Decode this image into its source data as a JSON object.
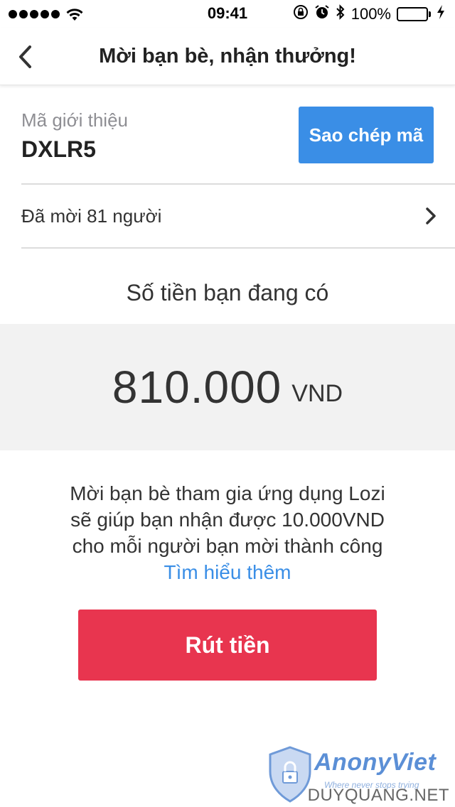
{
  "status_bar": {
    "time": "09:41",
    "battery_percent": "100%",
    "signal_bars": 5,
    "battery_color": "#4cd964"
  },
  "nav": {
    "title": "Mời bạn bè, nhận thưởng!",
    "back_icon": "chevron-left-icon"
  },
  "referral": {
    "label": "Mã giới thiệu",
    "code": "DXLR5",
    "copy_button": "Sao chép mã"
  },
  "invited": {
    "text": "Đã mời 81 người",
    "chevron_icon": "chevron-right-icon"
  },
  "balance": {
    "label": "Số tiền bạn đang có",
    "amount": "810.000",
    "currency": "VND"
  },
  "description": {
    "line1": "Mời bạn bè tham gia ứng dụng Lozi",
    "line2": "sẽ giúp bạn nhận được 10.000VND",
    "line3": "cho mỗi người bạn mời thành công",
    "learn_more": "Tìm hiểu thêm"
  },
  "withdraw_button": "Rút tiền",
  "watermark": {
    "brand": "AnonyViet",
    "tagline": "Where never stops trying",
    "site": "DUYQUANG.NET"
  },
  "colors": {
    "accent_blue": "#3a8ee6",
    "withdraw_red": "#e8354f",
    "balance_bg": "#f2f2f2"
  }
}
